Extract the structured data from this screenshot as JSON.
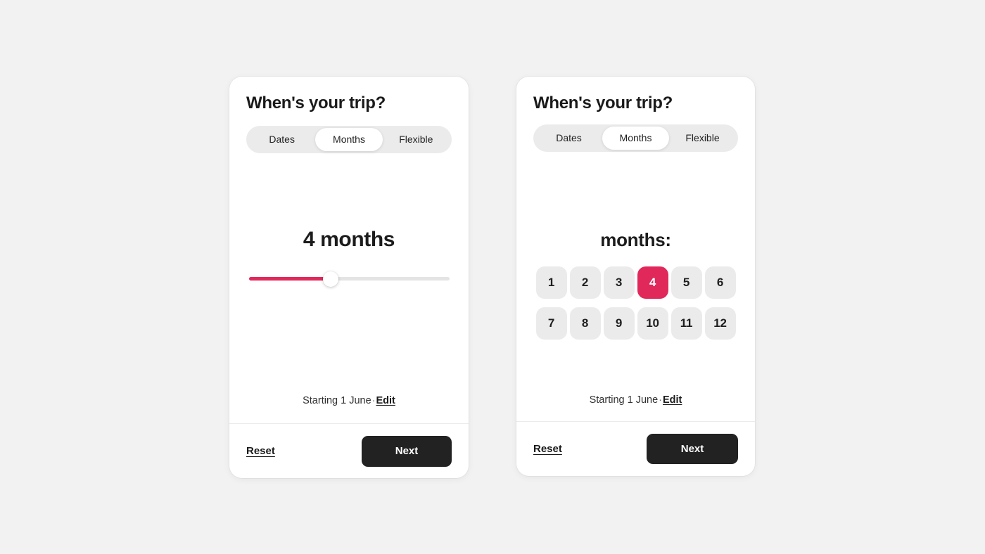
{
  "page": {
    "background_color": "#f2f2f2",
    "accent_color": "#e0285a",
    "dark_color": "#222222"
  },
  "cards": [
    {
      "id": "slider-variant",
      "title": "When's your trip?",
      "tabs": [
        {
          "label": "Dates",
          "active": false
        },
        {
          "label": "Months",
          "active": true
        },
        {
          "label": "Flexible",
          "active": false
        }
      ],
      "duration": {
        "value_label": "4 months",
        "value": 4,
        "min": 1,
        "max": 12,
        "fill_percent": 41
      },
      "starting": {
        "text": "Starting 1 June",
        "dot": "·",
        "edit_label": "Edit"
      },
      "footer": {
        "reset_label": "Reset",
        "next_label": "Next"
      }
    },
    {
      "id": "grid-variant",
      "title": "When's your trip?",
      "tabs": [
        {
          "label": "Dates",
          "active": false
        },
        {
          "label": "Months",
          "active": true
        },
        {
          "label": "Flexible",
          "active": false
        }
      ],
      "months": {
        "label": "months:",
        "selected": 4,
        "options": [
          "1",
          "2",
          "3",
          "4",
          "5",
          "6",
          "7",
          "8",
          "9",
          "10",
          "11",
          "12"
        ]
      },
      "starting": {
        "text": "Starting 1 June",
        "dot": "·",
        "edit_label": "Edit"
      },
      "footer": {
        "reset_label": "Reset",
        "next_label": "Next"
      }
    }
  ]
}
